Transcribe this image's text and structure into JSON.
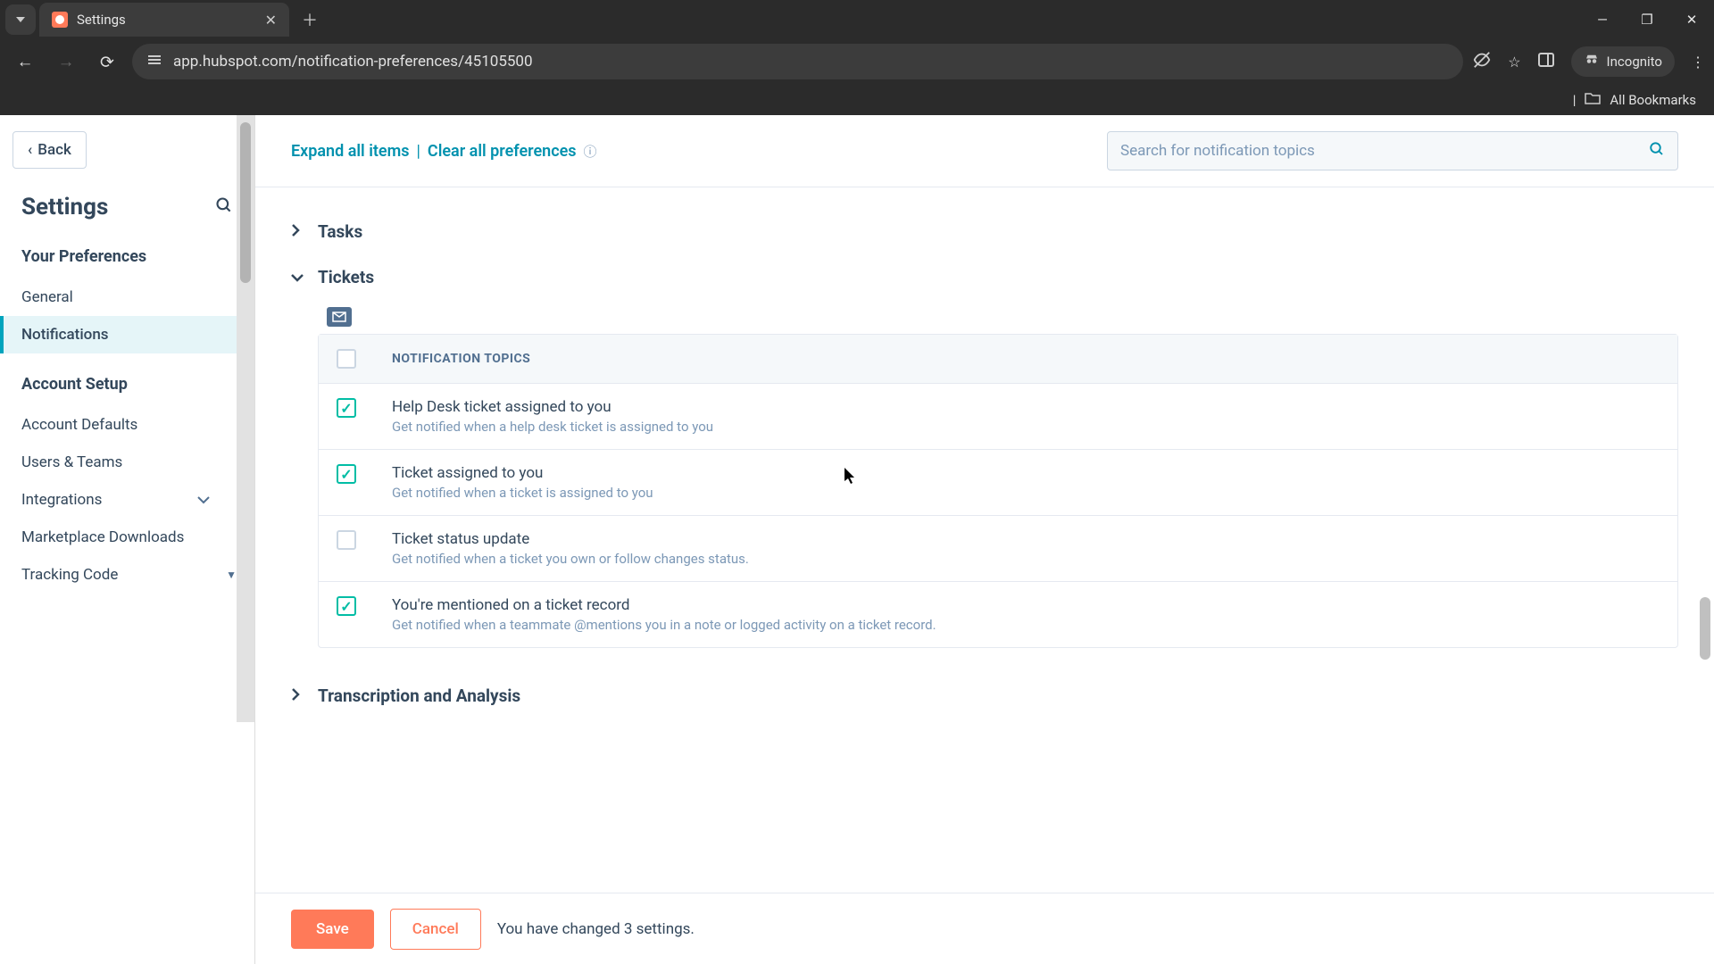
{
  "browser": {
    "tab_title": "Settings",
    "url": "app.hubspot.com/notification-preferences/45105500",
    "incognito": "Incognito",
    "all_bookmarks": "All Bookmarks"
  },
  "sidebar": {
    "back": "Back",
    "title": "Settings",
    "your_prefs_label": "Your Preferences",
    "general": "General",
    "notifications": "Notifications",
    "account_setup_label": "Account Setup",
    "account_defaults": "Account Defaults",
    "users_teams": "Users & Teams",
    "integrations": "Integrations",
    "marketplace": "Marketplace Downloads",
    "tracking_code": "Tracking Code"
  },
  "actions": {
    "expand_all": "Expand all items",
    "clear_all": "Clear all preferences"
  },
  "search": {
    "placeholder": "Search for notification topics"
  },
  "sections": {
    "tasks": "Tasks",
    "tickets": "Tickets",
    "transcription": "Transcription and Analysis"
  },
  "topics_header": "NOTIFICATION TOPICS",
  "topics": [
    {
      "title": "Help Desk ticket assigned to you",
      "desc": "Get notified when a help desk ticket is assigned to you",
      "checked": true
    },
    {
      "title": "Ticket assigned to you",
      "desc": "Get notified when a ticket is assigned to you",
      "checked": true
    },
    {
      "title": "Ticket status update",
      "desc": "Get notified when a ticket you own or follow changes status.",
      "checked": false
    },
    {
      "title": "You're mentioned on a ticket record",
      "desc": "Get notified when a teammate @mentions you in a note or logged activity on a ticket record.",
      "checked": true
    }
  ],
  "footer": {
    "save": "Save",
    "cancel": "Cancel",
    "message": "You have changed 3 settings."
  }
}
